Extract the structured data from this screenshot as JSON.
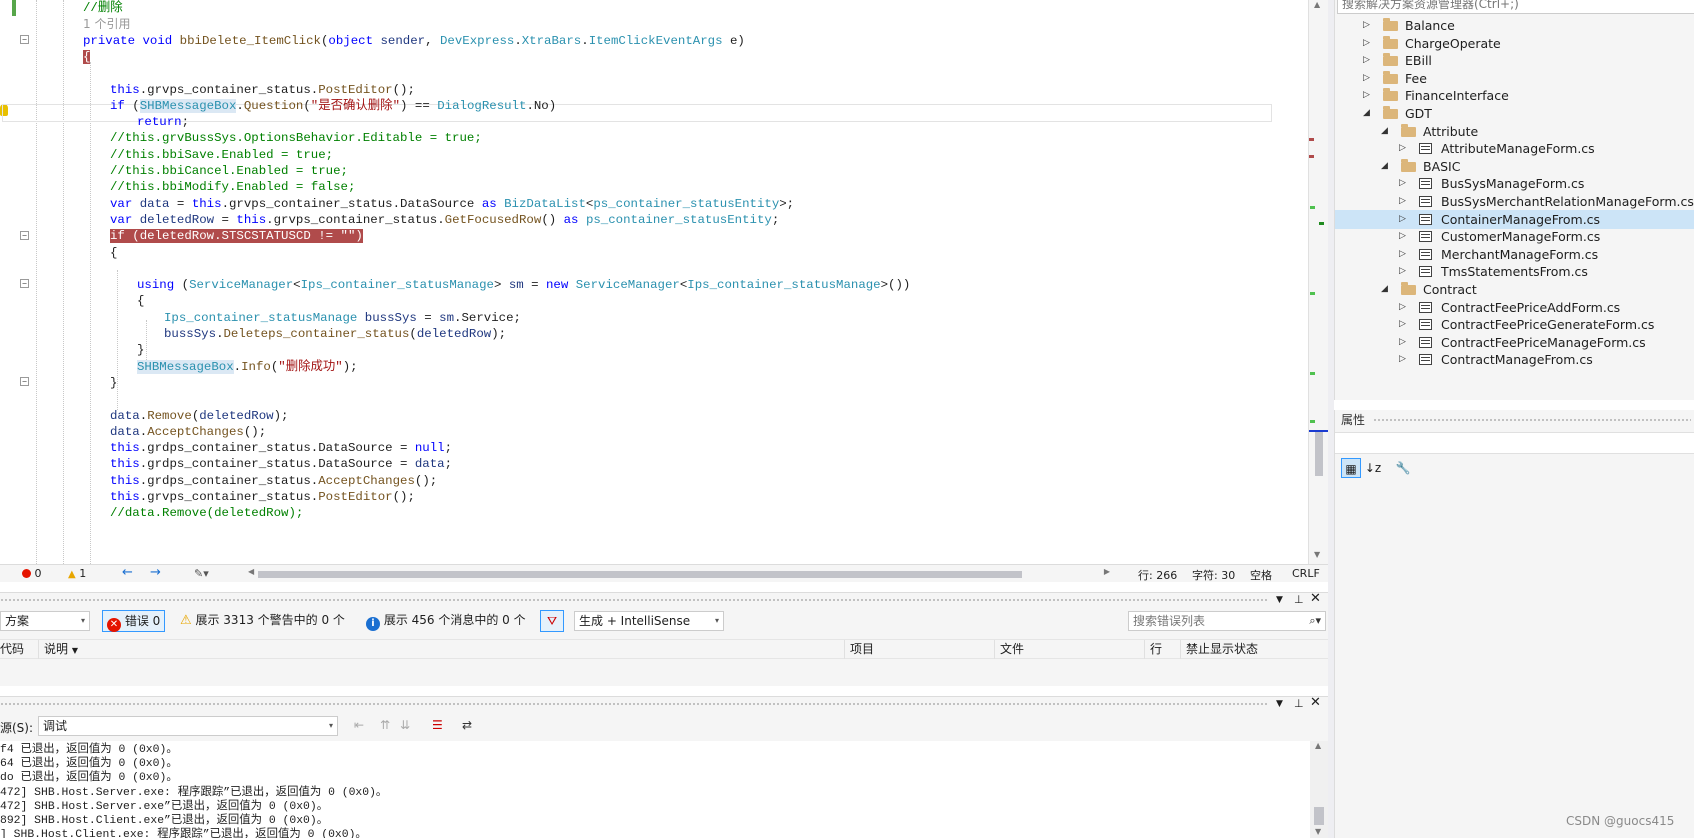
{
  "editor": {
    "lines": [
      {
        "indent": 1,
        "parts": [
          {
            "t": "//删除",
            "c": "c"
          }
        ]
      },
      {
        "indent": 1,
        "parts": [
          {
            "t": "1 个引用",
            "c": "refs"
          }
        ]
      },
      {
        "indent": 1,
        "parts": [
          {
            "t": "private void ",
            "c": "k"
          },
          {
            "t": "bbiDelete_ItemClick",
            "c": "m"
          },
          {
            "t": "(",
            "c": ""
          },
          {
            "t": "object ",
            "c": "k"
          },
          {
            "t": "sender",
            "c": "p"
          },
          {
            "t": ", ",
            "c": ""
          },
          {
            "t": "DevExpress",
            "c": "cl"
          },
          {
            "t": ".",
            "c": ""
          },
          {
            "t": "XtraBars",
            "c": "cl"
          },
          {
            "t": ".",
            "c": ""
          },
          {
            "t": "ItemClickEventArgs",
            "c": "cl"
          },
          {
            "t": " e)",
            "c": ""
          }
        ]
      },
      {
        "indent": 1,
        "parts": [
          {
            "t": "{",
            "c": "hl-brace"
          }
        ]
      },
      {
        "indent": 2,
        "parts": [
          {
            "t": "",
            "c": ""
          }
        ]
      },
      {
        "indent": 2,
        "parts": [
          {
            "t": "this",
            "c": "k"
          },
          {
            "t": ".grvps_container_status.",
            "c": ""
          },
          {
            "t": "PostEditor",
            "c": "m"
          },
          {
            "t": "();",
            "c": ""
          }
        ]
      },
      {
        "indent": 2,
        "parts": [
          {
            "t": "if",
            "c": "k"
          },
          {
            "t": " (",
            "c": ""
          },
          {
            "t": "SHBMessageBox",
            "c": "cl hl-word"
          },
          {
            "t": ".",
            "c": ""
          },
          {
            "t": "Question",
            "c": "m"
          },
          {
            "t": "(",
            "c": ""
          },
          {
            "t": "\"是否确认删除\"",
            "c": "s"
          },
          {
            "t": ") == ",
            "c": ""
          },
          {
            "t": "DialogResult",
            "c": "cl"
          },
          {
            "t": ".No)",
            "c": ""
          }
        ]
      },
      {
        "indent": 3,
        "parts": [
          {
            "t": "return",
            "c": "k"
          },
          {
            "t": ";",
            "c": ""
          }
        ]
      },
      {
        "indent": 2,
        "parts": [
          {
            "t": "//this.grvBussSys.OptionsBehavior.Editable = true;",
            "c": "c"
          }
        ]
      },
      {
        "indent": 2,
        "parts": [
          {
            "t": "//this.bbiSave.Enabled = true;",
            "c": "c"
          }
        ]
      },
      {
        "indent": 2,
        "parts": [
          {
            "t": "//this.bbiCancel.Enabled = true;",
            "c": "c"
          }
        ]
      },
      {
        "indent": 2,
        "parts": [
          {
            "t": "//this.bbiModify.Enabled = false;",
            "c": "c"
          }
        ]
      },
      {
        "indent": 2,
        "parts": [
          {
            "t": "var ",
            "c": "k"
          },
          {
            "t": "data",
            "c": "p"
          },
          {
            "t": " = ",
            "c": ""
          },
          {
            "t": "this",
            "c": "k"
          },
          {
            "t": ".grvps_container_status.DataSource ",
            "c": ""
          },
          {
            "t": "as ",
            "c": "k"
          },
          {
            "t": "BizDataList",
            "c": "cl"
          },
          {
            "t": "<",
            "c": ""
          },
          {
            "t": "ps_container_statusEntity",
            "c": "cl"
          },
          {
            "t": ">;",
            "c": ""
          }
        ]
      },
      {
        "indent": 2,
        "parts": [
          {
            "t": "var ",
            "c": "k"
          },
          {
            "t": "deletedRow",
            "c": "p"
          },
          {
            "t": " = ",
            "c": ""
          },
          {
            "t": "this",
            "c": "k"
          },
          {
            "t": ".grvps_container_status.",
            "c": ""
          },
          {
            "t": "GetFocusedRow",
            "c": "m"
          },
          {
            "t": "() ",
            "c": ""
          },
          {
            "t": "as ",
            "c": "k"
          },
          {
            "t": "ps_container_statusEntity",
            "c": "cl"
          },
          {
            "t": ";",
            "c": ""
          }
        ]
      },
      {
        "indent": 2,
        "parts": [
          {
            "t": "if (deletedRow.STSCSTATUSCD != \"\")",
            "c": "hl-line"
          }
        ]
      },
      {
        "indent": 2,
        "parts": [
          {
            "t": "{",
            "c": ""
          }
        ]
      },
      {
        "indent": 3,
        "parts": [
          {
            "t": "",
            "c": ""
          }
        ]
      },
      {
        "indent": 3,
        "parts": [
          {
            "t": "using",
            "c": "k"
          },
          {
            "t": " (",
            "c": ""
          },
          {
            "t": "ServiceManager",
            "c": "cl"
          },
          {
            "t": "<",
            "c": ""
          },
          {
            "t": "Ips_container_statusManage",
            "c": "cl"
          },
          {
            "t": "> ",
            "c": ""
          },
          {
            "t": "sm",
            "c": "p"
          },
          {
            "t": " = ",
            "c": ""
          },
          {
            "t": "new ",
            "c": "k"
          },
          {
            "t": "ServiceManager",
            "c": "cl"
          },
          {
            "t": "<",
            "c": ""
          },
          {
            "t": "Ips_container_statusManage",
            "c": "cl"
          },
          {
            "t": ">())",
            "c": ""
          }
        ]
      },
      {
        "indent": 3,
        "parts": [
          {
            "t": "{",
            "c": ""
          }
        ]
      },
      {
        "indent": 4,
        "parts": [
          {
            "t": "Ips_container_statusManage ",
            "c": "cl"
          },
          {
            "t": "bussSys",
            "c": "p"
          },
          {
            "t": " = ",
            "c": ""
          },
          {
            "t": "sm",
            "c": "p"
          },
          {
            "t": ".Service;",
            "c": ""
          }
        ]
      },
      {
        "indent": 4,
        "parts": [
          {
            "t": "bussSys",
            "c": "p"
          },
          {
            "t": ".",
            "c": ""
          },
          {
            "t": "Deleteps_container_status",
            "c": "m"
          },
          {
            "t": "(",
            "c": ""
          },
          {
            "t": "deletedRow",
            "c": "p"
          },
          {
            "t": ");",
            "c": ""
          }
        ]
      },
      {
        "indent": 3,
        "parts": [
          {
            "t": "}",
            "c": ""
          }
        ]
      },
      {
        "indent": 3,
        "parts": [
          {
            "t": "SHBMessageBox",
            "c": "cl hl-word"
          },
          {
            "t": ".",
            "c": ""
          },
          {
            "t": "Info",
            "c": "m"
          },
          {
            "t": "(",
            "c": ""
          },
          {
            "t": "\"删除成功\"",
            "c": "s"
          },
          {
            "t": ");",
            "c": ""
          }
        ]
      },
      {
        "indent": 2,
        "parts": [
          {
            "t": "}",
            "c": ""
          }
        ]
      },
      {
        "indent": 2,
        "parts": [
          {
            "t": "",
            "c": ""
          }
        ]
      },
      {
        "indent": 2,
        "parts": [
          {
            "t": "data",
            "c": "p"
          },
          {
            "t": ".",
            "c": ""
          },
          {
            "t": "Remove",
            "c": "m"
          },
          {
            "t": "(",
            "c": ""
          },
          {
            "t": "deletedRow",
            "c": "p"
          },
          {
            "t": ");",
            "c": ""
          }
        ]
      },
      {
        "indent": 2,
        "parts": [
          {
            "t": "data",
            "c": "p"
          },
          {
            "t": ".",
            "c": ""
          },
          {
            "t": "AcceptChanges",
            "c": "m"
          },
          {
            "t": "();",
            "c": ""
          }
        ]
      },
      {
        "indent": 2,
        "parts": [
          {
            "t": "this",
            "c": "k"
          },
          {
            "t": ".grdps_container_status.DataSource = ",
            "c": ""
          },
          {
            "t": "null",
            "c": "k"
          },
          {
            "t": ";",
            "c": ""
          }
        ]
      },
      {
        "indent": 2,
        "parts": [
          {
            "t": "this",
            "c": "k"
          },
          {
            "t": ".grdps_container_status.DataSource = ",
            "c": ""
          },
          {
            "t": "data",
            "c": "p"
          },
          {
            "t": ";",
            "c": ""
          }
        ]
      },
      {
        "indent": 2,
        "parts": [
          {
            "t": "this",
            "c": "k"
          },
          {
            "t": ".grdps_container_status.",
            "c": ""
          },
          {
            "t": "AcceptChanges",
            "c": "m"
          },
          {
            "t": "();",
            "c": ""
          }
        ]
      },
      {
        "indent": 2,
        "parts": [
          {
            "t": "this",
            "c": "k"
          },
          {
            "t": ".grvps_container_status.",
            "c": ""
          },
          {
            "t": "PostEditor",
            "c": "m"
          },
          {
            "t": "();",
            "c": ""
          }
        ]
      },
      {
        "indent": 2,
        "parts": [
          {
            "t": "//data.Remove(deletedRow);",
            "c": "c"
          }
        ]
      }
    ]
  },
  "status_bar": {
    "errors": "0",
    "warnings": "1",
    "line": "行: 266",
    "char": "字符: 30",
    "spaces": "空格",
    "eol": "CRLF"
  },
  "solution_explorer": {
    "search_placeholder": "搜索解决方案资源管理器(Ctrl+;)",
    "items": [
      {
        "label": "Balance",
        "type": "folder",
        "level": 0,
        "expanded": false
      },
      {
        "label": "ChargeOperate",
        "type": "folder",
        "level": 0,
        "expanded": false
      },
      {
        "label": "EBill",
        "type": "folder",
        "level": 0,
        "expanded": false
      },
      {
        "label": "Fee",
        "type": "folder",
        "level": 0,
        "expanded": false
      },
      {
        "label": "FinanceInterface",
        "type": "folder",
        "level": 0,
        "expanded": false
      },
      {
        "label": "GDT",
        "type": "folder",
        "level": 0,
        "expanded": true
      },
      {
        "label": "Attribute",
        "type": "folder",
        "level": 1,
        "expanded": true
      },
      {
        "label": "AttributeManageForm.cs",
        "type": "form",
        "level": 2,
        "expanded": false
      },
      {
        "label": "BASIC",
        "type": "folder",
        "level": 1,
        "expanded": true
      },
      {
        "label": "BusSysManageForm.cs",
        "type": "form",
        "level": 2,
        "expanded": false
      },
      {
        "label": "BusSysMerchantRelationManageForm.cs",
        "type": "form",
        "level": 2,
        "expanded": false
      },
      {
        "label": "ContainerManageFrom.cs",
        "type": "form",
        "level": 2,
        "expanded": false,
        "selected": true
      },
      {
        "label": "CustomerManageForm.cs",
        "type": "form",
        "level": 2,
        "expanded": false
      },
      {
        "label": "MerchantManageForm.cs",
        "type": "form",
        "level": 2,
        "expanded": false
      },
      {
        "label": "TmsStatementsFrom.cs",
        "type": "form",
        "level": 2,
        "expanded": false
      },
      {
        "label": "Contract",
        "type": "folder",
        "level": 1,
        "expanded": true
      },
      {
        "label": "ContractFeePriceAddForm.cs",
        "type": "form",
        "level": 2,
        "expanded": false
      },
      {
        "label": "ContractFeePriceGenerateForm.cs",
        "type": "form",
        "level": 2,
        "expanded": false
      },
      {
        "label": "ContractFeePriceManageForm.cs",
        "type": "form",
        "level": 2,
        "expanded": false
      },
      {
        "label": "ContractManageFrom.cs",
        "type": "form",
        "level": 2,
        "expanded": false
      }
    ]
  },
  "properties": {
    "title": "属性"
  },
  "error_list": {
    "scope": "方案",
    "errors_btn": "错误 0",
    "warnings_btn": "展示 3313 个警告中的 0 个",
    "messages_btn": "展示 456 个消息中的 0 个",
    "build_filter": "生成 + IntelliSense",
    "search_placeholder": "搜索错误列表",
    "columns": [
      "代码",
      "说明",
      "项目",
      "文件",
      "行",
      "禁止显示状态"
    ]
  },
  "output": {
    "source_label": "源(S):",
    "source_value": "调试",
    "lines": [
      "f4 已退出，返回值为 0 (0x0)。",
      "64 已退出，返回值为 0 (0x0)。",
      "do 已退出，返回值为 0 (0x0)。",
      "472] SHB.Host.Server.exe: 程序跟踪”已退出，返回值为 0 (0x0)。",
      "472] SHB.Host.Server.exe”已退出，返回值为 0 (0x0)。",
      "892] SHB.Host.Client.exe”已退出，返回值为 0 (0x0)。",
      "] SHB.Host.Client.exe: 程序跟踪”已退出，返回值为 0 (0x0)。"
    ]
  },
  "watermark": "CSDN @guocs415",
  "colors": {
    "accent": "#3399ff",
    "selection": "#cce4f7",
    "error": "#e51400",
    "warning": "#e8a600",
    "breakpoint_highlight": "#b04b4b"
  }
}
